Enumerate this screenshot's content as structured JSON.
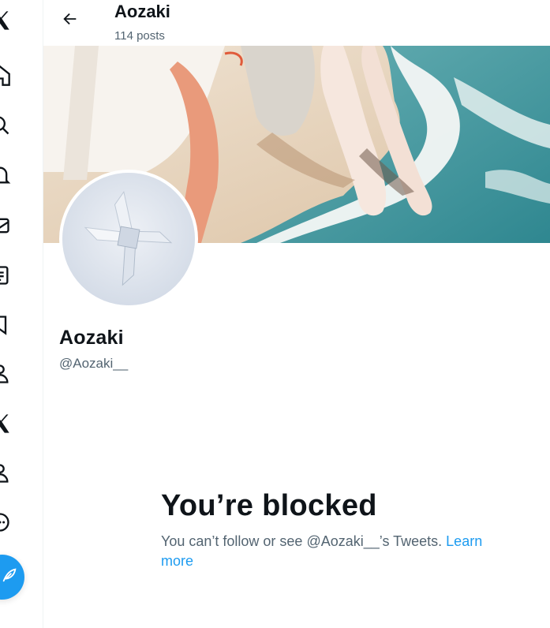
{
  "header": {
    "name": "Aozaki",
    "post_count": "114 posts"
  },
  "profile": {
    "display_name": "Aozaki",
    "handle": "@Aozaki__"
  },
  "blocked": {
    "title": "You’re blocked",
    "message": "You can’t follow or see @Aozaki__’s Tweets.",
    "link_label": "Learn more"
  },
  "nav": {
    "items": [
      "x-logo-icon",
      "home-icon",
      "search-icon",
      "notifications-icon",
      "messages-icon",
      "lists-icon",
      "communities-icon",
      "profile-icon",
      "premium-icon",
      "people-icon",
      "more-icon",
      "compose-icon"
    ]
  },
  "colors": {
    "accent": "#1d9bf0",
    "text": "#0f1419",
    "muted": "#536471"
  }
}
